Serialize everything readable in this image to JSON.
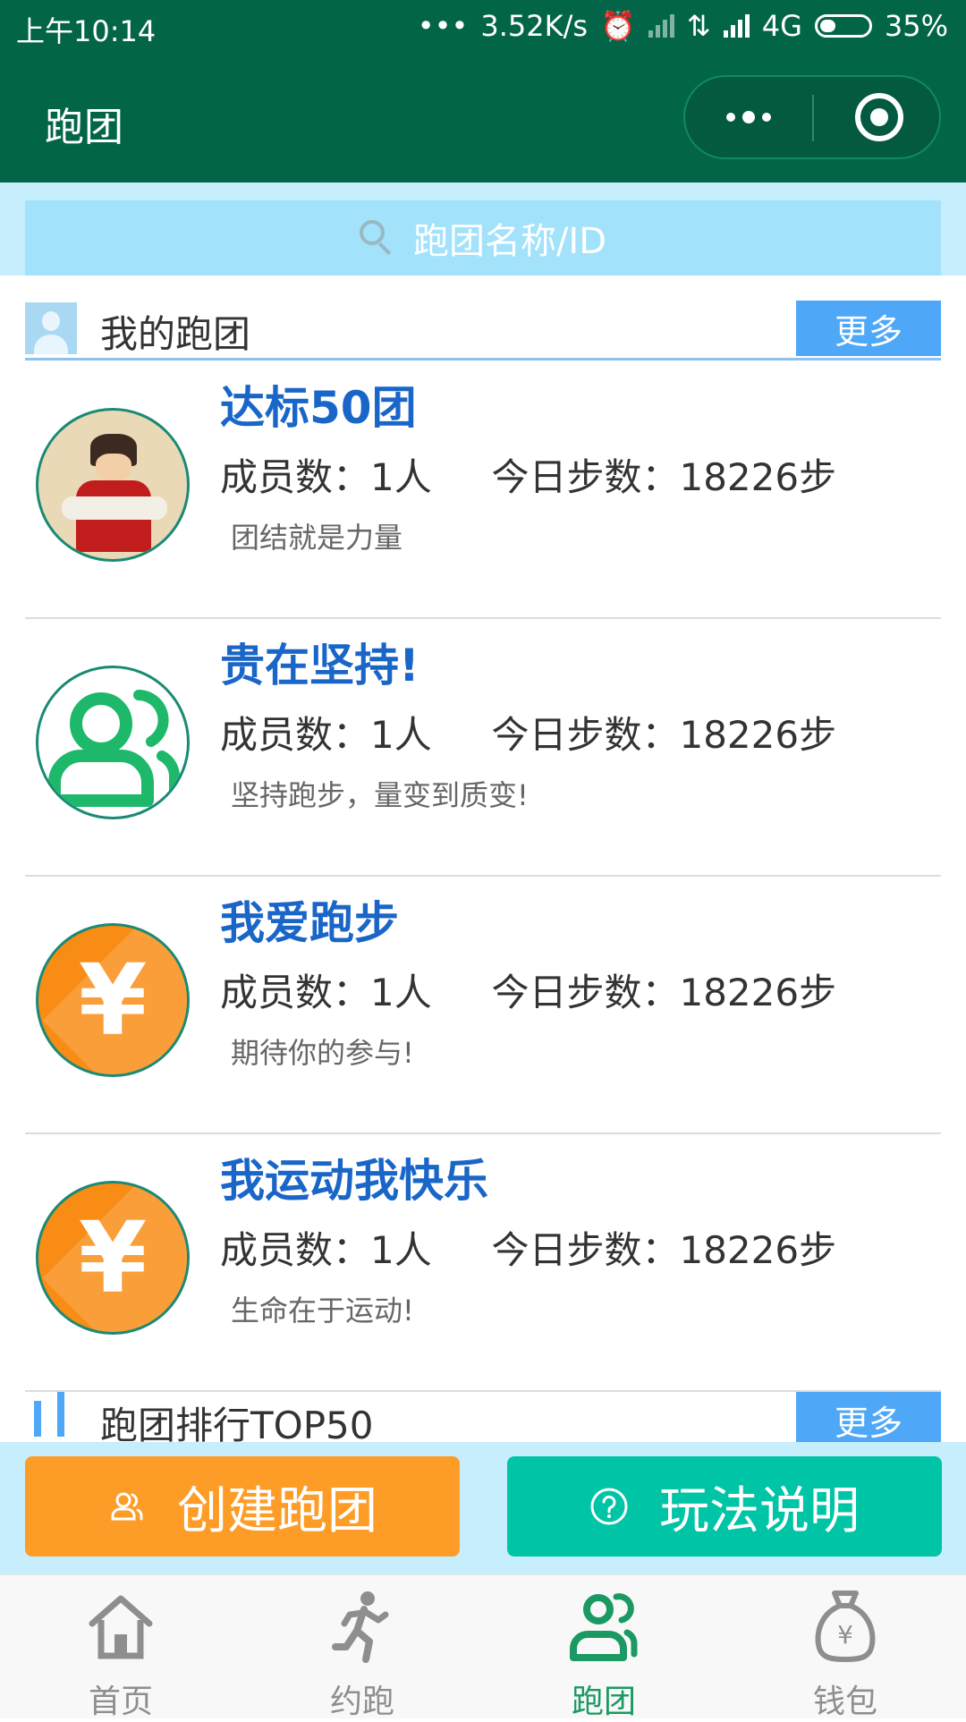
{
  "status_bar": {
    "time": "上午10:14",
    "network_speed": "3.52K/s",
    "network_type": "4G",
    "battery": "35%"
  },
  "nav": {
    "title": "跑团"
  },
  "search": {
    "placeholder": "跑团名称/ID"
  },
  "my_teams": {
    "title": "我的跑团",
    "more_label": "更多",
    "teams": [
      {
        "name": "达标50团",
        "stats": "成员数：1人     今日步数：18226步",
        "motto": "团结就是力量",
        "avatar": "anime-character-avatar"
      },
      {
        "name": "贵在坚持!",
        "stats": "成员数：1人     今日步数：18226步",
        "motto": "坚持跑步，量变到质变!",
        "avatar": "group-icon-avatar"
      },
      {
        "name": "我爱跑步",
        "stats": "成员数：1人     今日步数：18226步",
        "motto": "期待你的参与!",
        "avatar": "yen-coin-avatar"
      },
      {
        "name": "我运动我快乐",
        "stats": "成员数：1人     今日步数：18226步",
        "motto": "生命在于运动!",
        "avatar": "yen-coin-avatar"
      }
    ]
  },
  "ranking": {
    "title": "跑团排行TOP50",
    "more_label": "更多"
  },
  "actions": {
    "create_label": "创建跑团",
    "rules_label": "玩法说明"
  },
  "tabs": [
    {
      "label": "首页",
      "icon": "home-icon"
    },
    {
      "label": "约跑",
      "icon": "runner-icon"
    },
    {
      "label": "跑团",
      "icon": "group-icon",
      "active": true
    },
    {
      "label": "钱包",
      "icon": "money-bag-icon"
    }
  ],
  "colors": {
    "header": "#036548",
    "accent_blue": "#4ea8f7",
    "team_name": "#1a66c8",
    "create_button": "#fd9d27",
    "rules_button": "#00c4a6",
    "active_tab": "#1a9a62"
  }
}
